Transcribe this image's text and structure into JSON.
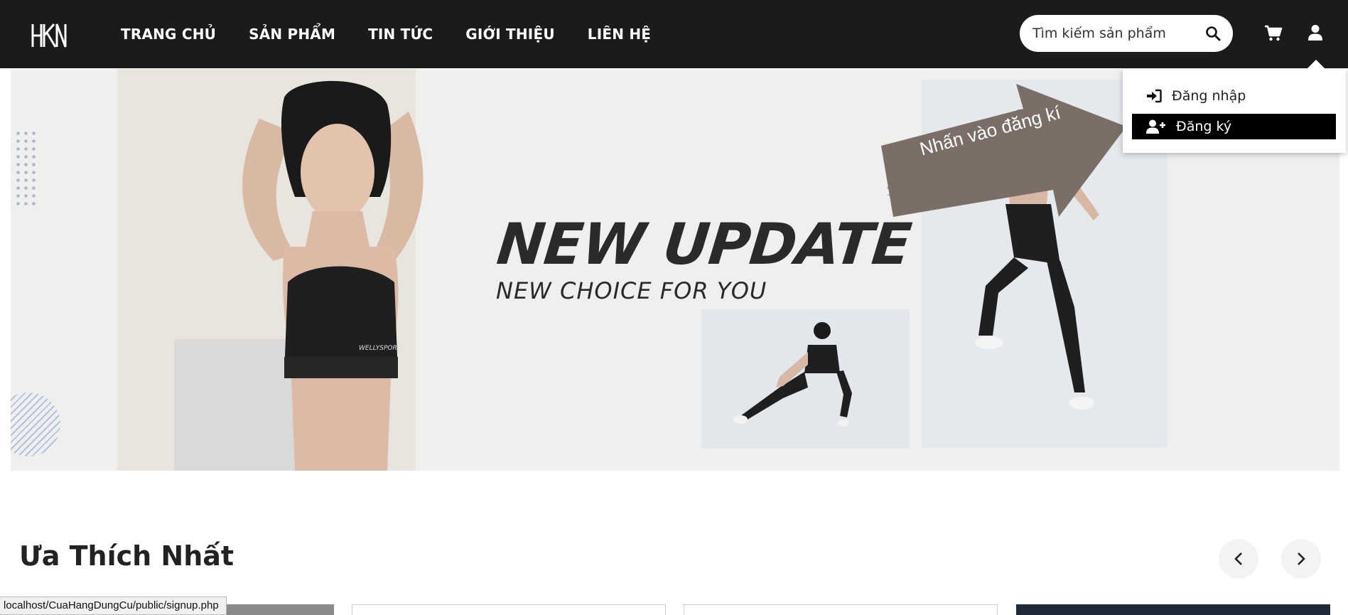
{
  "header": {
    "logo_text": "HKN",
    "nav": [
      "TRANG CHỦ",
      "SẢN PHẨM",
      "TIN TỨC",
      "GIỚI THIỆU",
      "LIÊN HỆ"
    ],
    "search": {
      "placeholder": "Tìm kiếm sản phẩm"
    },
    "icons": [
      "search-icon",
      "cart-icon",
      "user-icon"
    ]
  },
  "account_menu": {
    "items": [
      {
        "label": "Đăng nhập",
        "icon": "sign-in-icon"
      },
      {
        "label": "Đăng ký",
        "icon": "user-plus-icon"
      }
    ]
  },
  "banner": {
    "headline": "NEW UPDATE",
    "subline": "NEW CHOICE FOR YOU",
    "brand_mark": "WELLYSPORT"
  },
  "annotation": {
    "text": "Nhấn vào đăng kí",
    "color": "#7b6e67"
  },
  "section": {
    "title": "Ưa Thích Nhất",
    "prev_icon": "chevron-left-icon",
    "next_icon": "chevron-right-icon"
  },
  "status_bar": {
    "url": "localhost/CuaHangDungCu/public/signup.php"
  }
}
